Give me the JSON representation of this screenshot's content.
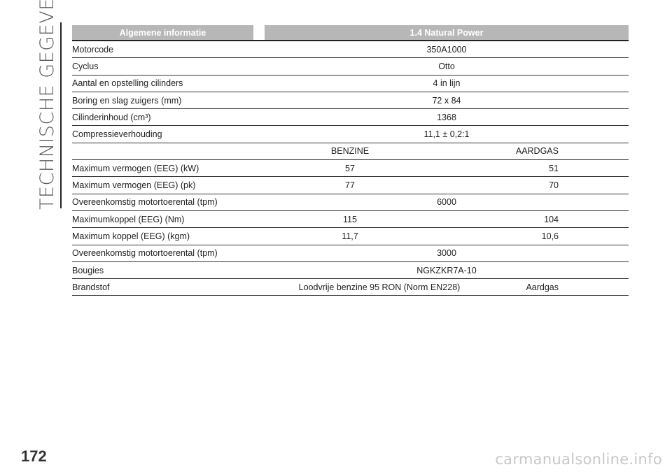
{
  "section_title": "TECHNISCHE GEGEVENS",
  "table": {
    "header": {
      "left": "Algemene informatie",
      "right": "1.4 Natural Power"
    },
    "rows": [
      {
        "label": "Motorcode",
        "value": "350A1000"
      },
      {
        "label": "Cyclus",
        "value": "Otto"
      },
      {
        "label": "Aantal en opstelling cilinders",
        "value": "4 in lijn"
      },
      {
        "label": "Boring en slag zuigers (mm)",
        "value": "72 x 84"
      },
      {
        "label": "Cilinderinhoud (cm³)",
        "value": "1368"
      },
      {
        "label": "Compressieverhouding",
        "value": "11,1 ± 0,2:1"
      },
      {
        "label": "",
        "value_a": "BENZINE",
        "value_b": "AARDGAS"
      },
      {
        "label": "Maximum vermogen (EEG) (kW)",
        "value_a": "57",
        "value_b": "51"
      },
      {
        "label": "Maximum vermogen (EEG) (pk)",
        "value_a": "77",
        "value_b": "70"
      },
      {
        "label": "Overeenkomstig motortoerental (tpm)",
        "value": "6000"
      },
      {
        "label": "Maximumkoppel (EEG) (Nm)",
        "value_a": "115",
        "value_b": "104"
      },
      {
        "label": "Maximum koppel (EEG) (kgm)",
        "value_a": "11,7",
        "value_b": "10,6"
      },
      {
        "label": "Overeenkomstig motortoerental (tpm)",
        "value": "3000"
      },
      {
        "label": "Bougies",
        "value": "NGKZKR7A-10"
      },
      {
        "label": "Brandstof",
        "value_a": "Loodvrije benzine 95 RON (Norm EN228)",
        "value_b": "Aardgas"
      }
    ]
  },
  "page_number": "172",
  "watermark": "carmanualsonline.info"
}
